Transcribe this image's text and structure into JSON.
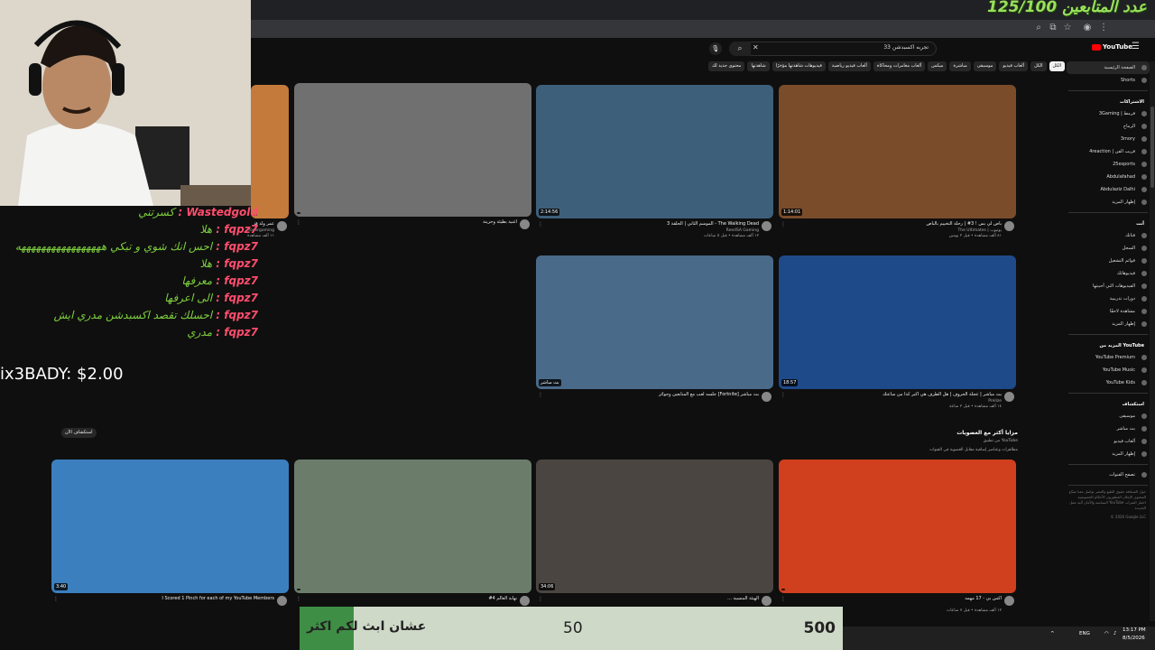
{
  "followers": {
    "label": "عدد المتابعين",
    "count": "125/100"
  },
  "youtube": {
    "search_text": "تجربه اكسبدشن 33",
    "logo_text": "YouTube",
    "chips": [
      {
        "label": "الكل",
        "active": true
      },
      {
        "label": "الكل",
        "active": false
      },
      {
        "label": "ألعاب فيديو",
        "active": false
      },
      {
        "label": "موسيقى",
        "active": false
      },
      {
        "label": "مباشرة",
        "active": false
      },
      {
        "label": "ميكس",
        "active": false
      },
      {
        "label": "ألعاب مغامرات ومحاكاة",
        "active": false
      },
      {
        "label": "ألعاب فيديو رياضية",
        "active": false
      },
      {
        "label": "فيديوهات شاهدتها مؤخرًا",
        "active": false
      },
      {
        "label": "شاهدتها",
        "active": false
      },
      {
        "label": "محتوى جديد لك",
        "active": false
      }
    ],
    "sidebar": {
      "top": [
        {
          "label": "الصفحة الرئيسية",
          "active": true
        },
        {
          "label": "Shorts",
          "active": false
        }
      ],
      "subs_head": "الاشتراكات",
      "subs": [
        {
          "label": "3Gaming | قرمط"
        },
        {
          "label": "الرماح"
        },
        {
          "label": "3mory"
        },
        {
          "label": "4reaction | قريب الفن"
        },
        {
          "label": "25esports"
        },
        {
          "label": "Abdulafahad"
        },
        {
          "label": "Abdulaziz Dalhi"
        },
        {
          "label": "إظهار المزيد"
        }
      ],
      "you_head": "أنت",
      "you": [
        {
          "label": "قناتك"
        },
        {
          "label": "السجل"
        },
        {
          "label": "قوائم التشغيل"
        },
        {
          "label": "فيديوهاتك"
        },
        {
          "label": "الفيديوهات التي أحببتها"
        },
        {
          "label": "دورات تدريبية"
        },
        {
          "label": "مشاهدة لاحقًا"
        },
        {
          "label": "إظهار المزيد"
        }
      ],
      "more_head": "المزيد من YouTube",
      "more": [
        {
          "label": "YouTube Premium"
        },
        {
          "label": "YouTube Music"
        },
        {
          "label": "YouTube Kids"
        }
      ],
      "explore_head": "استكشاف",
      "explore": [
        {
          "label": "موسيقى"
        },
        {
          "label": "بث مباشر"
        },
        {
          "label": "ألعاب فيديو"
        },
        {
          "label": "إظهار المزيد"
        }
      ],
      "browse_channels": "تصفح القنوات",
      "footer": "حول  الصحافة  حقوق الطبع والنشر  تواصل معنا  صنّاع المحتوى  الإعلان  المطورون  الأحكام  الخصوصية  السياسة والأمان  آلية عمل YouTube  اختبار الميزات الجديدة",
      "copyright": "© 2026 Google LLC"
    },
    "videos": [
      {
        "title": "باص لي بس ! 3# | رحلة التخييم بالباص",
        "channel": "The Ultimates | يوتيوب",
        "stats": "٨١ ألف مشاهدة • قبل ٢ يومين",
        "duration": "1:14:01",
        "color": "#7a4c2a"
      },
      {
        "title": "The Walking Dead - الموسم الثاني | الحلقة 3",
        "channel": "ReedSA Gaming",
        "stats": "١٢ ألف مشاهدة • قبل ٥ ساعات",
        "duration": "2:14:56",
        "color": "#3d5f7a"
      },
      {
        "title": "أغنية بطيئة وحزينة",
        "channel": "",
        "stats": "",
        "duration": "",
        "color": "#707070"
      },
      {
        "title": "عمر ولد في الأرض | الحلقة الأولى",
        "channel": "rovergaming",
        "stats": "١١ ألف مشاهدة",
        "duration": "",
        "color": "#c47a3a"
      },
      {
        "title": "بث مباشر | عجلة الحروف | هل الطرف هي اكبر كذا من ساعتك",
        "channel": "Prelize",
        "stats": "١٤ ألف مشاهدة • قبل ٢ ساعة",
        "duration": "18:57",
        "color": "#1f4a8a"
      },
      {
        "title": "بث مباشر [Fortnite] جلسه لعب مع المتابعين وجوائز",
        "channel": "",
        "stats": "",
        "duration": "بث مباشر",
        "color": "#4a6a8a"
      },
      {
        "title": "اكس بي - 17 مهمه",
        "channel": "",
        "stats": "١٢ ألف مشاهدة • قبل ٧ ساعات",
        "duration": "",
        "color": "#d0401e"
      },
      {
        "title": "نهاية العالم 4#",
        "channel": "",
        "stats": "",
        "duration": "",
        "color": "#6b7c6b"
      },
      {
        "title": "الهيئة المنسية ...",
        "channel": "",
        "stats": "",
        "duration": "34:06",
        "color": "#4a4540"
      },
      {
        "title": "I Scored 1 Pinch for each of my YouTube Members",
        "channel": "",
        "stats": "",
        "duration": "3:40",
        "color": "#3b7fbf"
      }
    ],
    "shorts": {
      "title": "مزايا أكثر مع العضويات",
      "subtitle": "من تطبيق YouTube",
      "desc": "مظاهرات وعناصر إضافية مقابل العضوية في القنوات"
    },
    "explore_button": "استكشاف الآن"
  },
  "chat": [
    {
      "user": "",
      "msg": "كسرتني"
    },
    {
      "user": "fqpz7",
      "msg": "هلا"
    },
    {
      "user": "fqpz7",
      "msg": "احس انك شوي و تبكي هههههههههههههههههه"
    },
    {
      "user": "fqpz7",
      "msg": "هلا"
    },
    {
      "user": "fqpz7",
      "msg": "معرفها"
    },
    {
      "user": "fqpz7",
      "msg": "الى اعرفها"
    },
    {
      "user": "fqpz7",
      "msg": "احسلك تقصد اكسبدشن مدري ايش"
    },
    {
      "user": "fqpz7",
      "msg": "مدري"
    }
  ],
  "chat_top_user": "Wastedgold",
  "donation": "ix3BADY: $2.00",
  "goal": {
    "label": "عشان ابث لكم اكثر",
    "current": "50",
    "target": "500",
    "progress": 0.1
  },
  "taskbar": {
    "lang": "ENG",
    "time": "13:17 PM",
    "date": "8/5/2026"
  },
  "colors": {
    "yt_red": "#ff0000",
    "chat_user": "#ff4d6d",
    "chat_msg": "#7ecf3e",
    "goal_fill": "#3f8e45"
  }
}
